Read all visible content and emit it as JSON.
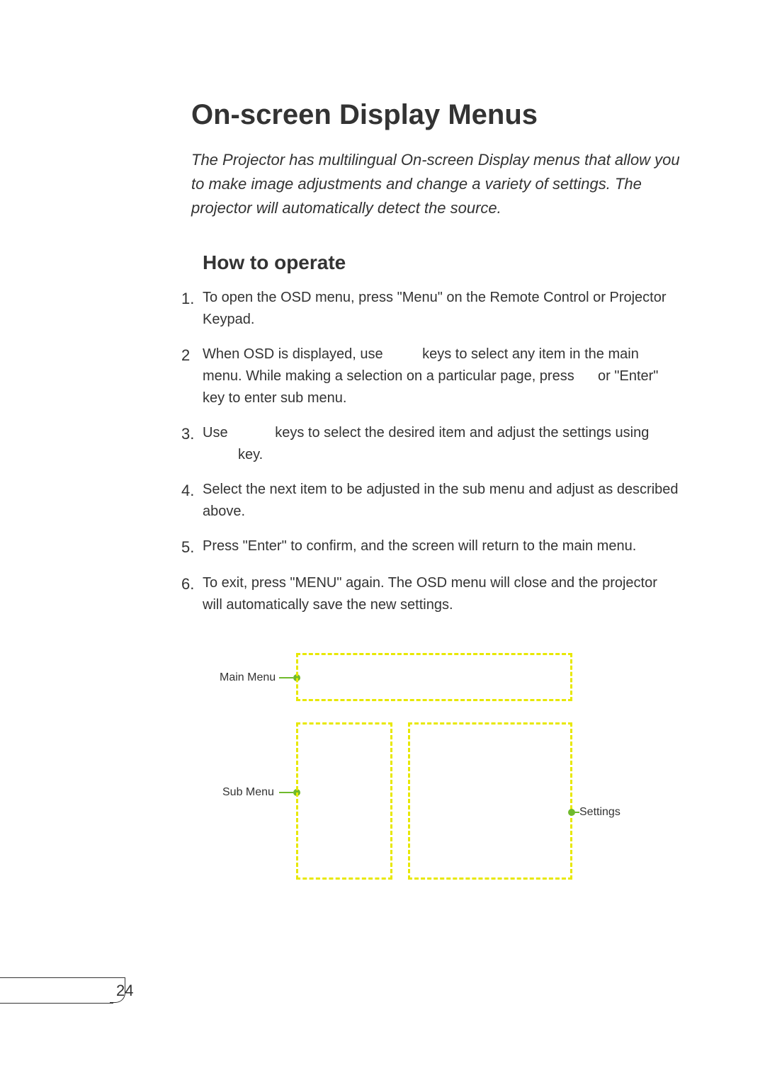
{
  "title": "On-screen Display Menus",
  "intro": "The Projector has multilingual On-screen Display menus that allow you to make image adjustments and change a variety of settings. The projector will automatically detect the source.",
  "subtitle": "How to operate",
  "steps": [
    {
      "num": "1.",
      "text": "To open the OSD menu, press \"Menu\" on the Remote Control or Projector Keypad."
    },
    {
      "num": "2",
      "text": "When OSD is displayed, use          keys to select any item in the main menu. While making a selection on a particular page, press      or \"Enter\" key to enter sub menu."
    },
    {
      "num": "3.",
      "text": "Use            keys to select the desired item and adjust the settings using          key."
    },
    {
      "num": "4.",
      "text": "Select the next item to be adjusted in the sub menu and adjust as described above."
    },
    {
      "num": "5.",
      "text": "Press \"Enter\" to confirm, and the screen will return to the main menu."
    },
    {
      "num": "6.",
      "text": "To exit, press \"MENU\" again. The OSD menu will close and the projector will automatically save the new settings."
    }
  ],
  "diagram": {
    "main_label": "Main Menu",
    "sub_label": "Sub Menu",
    "settings_label": "Settings"
  },
  "page_number": "24"
}
